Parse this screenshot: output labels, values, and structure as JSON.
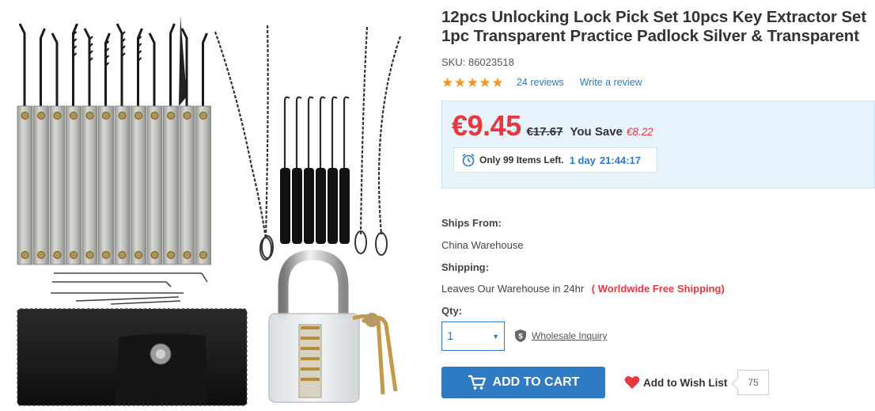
{
  "product": {
    "title": "12pcs Unlocking Lock Pick Set 10pcs Key Extractor Set 1pc Transparent Practice Padlock Silver & Transparent",
    "sku_label": "SKU:",
    "sku_value": "86023518",
    "rating_stars": 5,
    "reviews_link": "24 reviews",
    "write_review": "Write a review",
    "image_icon": "lock-pick-set-product-image"
  },
  "pricing": {
    "current_price": "€9.45",
    "original_price": "€17.67",
    "you_save_label": "You Save",
    "save_amount": "€8.22",
    "countdown_text": "Only 99 Items Left.",
    "countdown_days": "1 day",
    "countdown_time": "21:44:17"
  },
  "shipping": {
    "ships_from_label": "Ships From:",
    "ships_from_value": "China Warehouse",
    "shipping_label": "Shipping:",
    "shipping_value": "Leaves Our Warehouse in 24hr",
    "free_shipping": "( Worldwide Free Shipping)"
  },
  "purchase": {
    "qty_label": "Qty:",
    "qty_value": "1",
    "wholesale_inquiry": "Wholesale Inquiry",
    "add_to_cart": "ADD TO CART",
    "add_to_wishlist": "Add to Wish List",
    "wishlist_count": "75"
  },
  "colors": {
    "accent_blue": "#2e7bc4",
    "price_red": "#e8373f",
    "star_orange": "#f7941d",
    "price_box_bg": "#e8f4fb"
  }
}
